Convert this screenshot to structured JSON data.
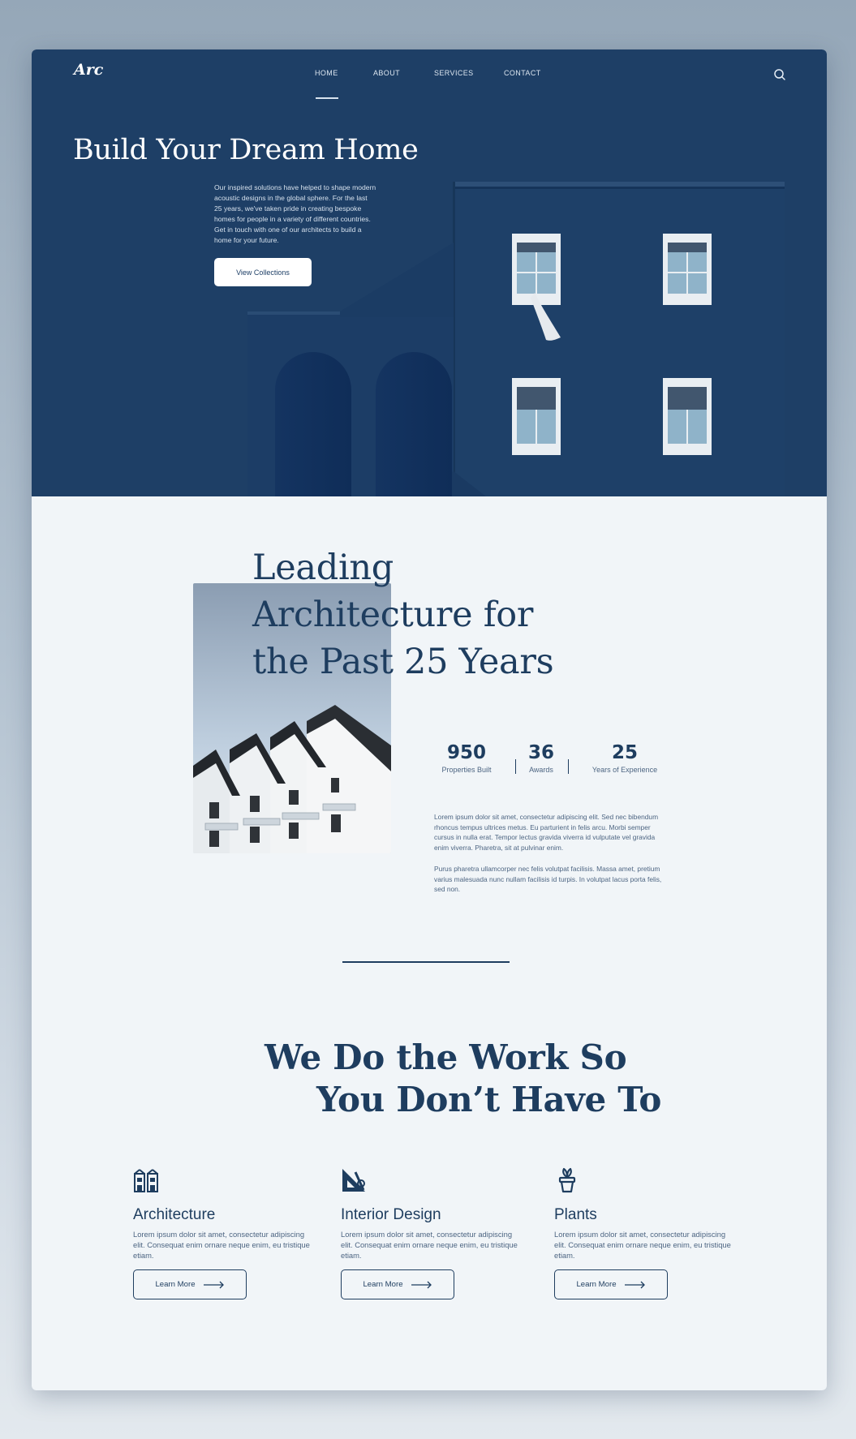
{
  "header": {
    "logo": "Arc",
    "nav": [
      {
        "label": "HOME",
        "active": true
      },
      {
        "label": "ABOUT",
        "active": false
      },
      {
        "label": "SERVICES",
        "active": false
      },
      {
        "label": "CONTACT",
        "active": false
      }
    ],
    "search_icon": "search-icon"
  },
  "hero": {
    "title": "Build Your Dream Home",
    "text": "Our inspired solutions have helped to shape modern acoustic designs in the global sphere. For the last 25 years, we've taken pride in creating bespoke homes for people in a variety of different countries. Get in touch with one of our architects to build a home for your future.",
    "button_label": "View Collections"
  },
  "about": {
    "title_lines": [
      "Leading",
      "Architecture for",
      "the Past 25 Years"
    ],
    "stats": [
      {
        "value": "950",
        "label": "Properties Built"
      },
      {
        "value": "36",
        "label": "Awards"
      },
      {
        "value": "25",
        "label": "Years of Experience"
      }
    ],
    "paragraphs": [
      "Lorem ipsum dolor sit amet, consectetur adipiscing elit. Sed nec bibendum rhoncus tempus ultrices metus. Eu parturient in felis arcu. Morbi semper cursus in nulla erat. Tempor lectus gravida viverra id vulputate vel gravida enim viverra. Pharetra, sit at pulvinar enim.",
      "Purus pharetra ullamcorper nec felis volutpat facilisis. Massa amet, pretium varius malesuada nunc nullam facilisis id turpis. In volutpat lacus porta felis, sed non."
    ]
  },
  "services": {
    "title_line_1": "We Do the Work So",
    "title_line_2": "You Don’t Have To",
    "items": [
      {
        "icon": "building-icon",
        "title": "Architecture",
        "text": "Lorem ipsum dolor sit amet, consectetur adipiscing elit. Consequat enim ornare neque enim, eu tristique etiam.",
        "button": "Learn More"
      },
      {
        "icon": "ruler-triangle-icon",
        "title": "Interior Design",
        "text": "Lorem ipsum dolor sit amet, consectetur adipiscing elit. Consequat enim ornare neque enim, eu tristique etiam.",
        "button": "Learn More"
      },
      {
        "icon": "plant-pot-icon",
        "title": "Plants",
        "text": "Lorem ipsum dolor sit amet, consectetur adipiscing elit. Consequat enim ornare neque enim, eu tristique etiam.",
        "button": "Learn More"
      }
    ]
  },
  "colors": {
    "primary": "#1e3f66",
    "text_dark": "#1e3d5f",
    "text_muted": "#4d6582",
    "background": "#f1f5f8"
  }
}
